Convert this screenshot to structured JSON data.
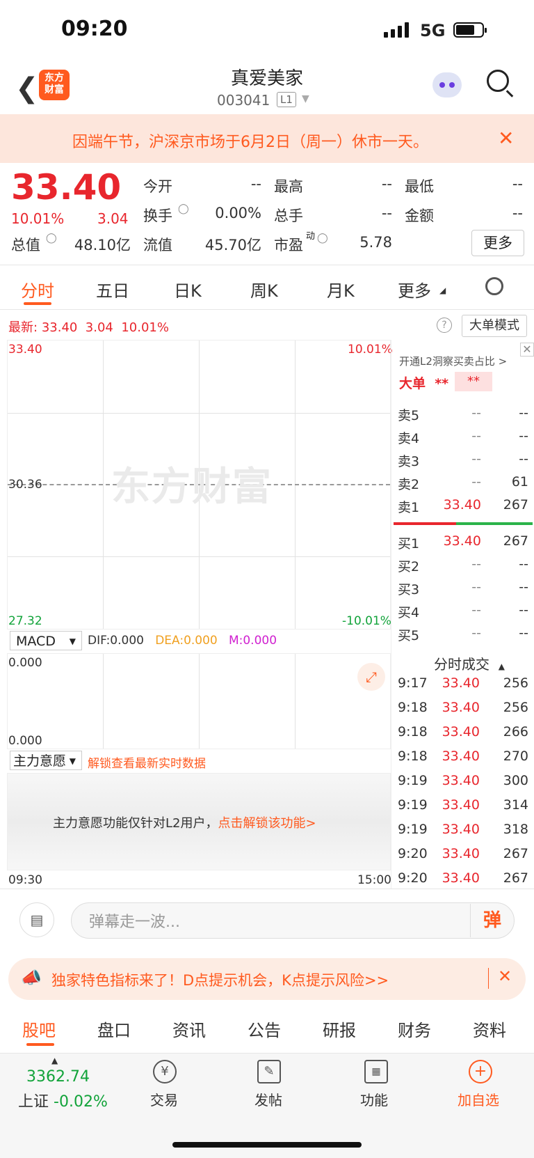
{
  "status_bar": {
    "time": "09:20",
    "network": "5G"
  },
  "header": {
    "logo_line1": "东方",
    "logo_line2": "财富",
    "stock_name": "真爱美家",
    "stock_code": "003041",
    "level_badge": "L1"
  },
  "notice": {
    "text": "因端午节，沪深京市场于6月2日（周一）休市一天。"
  },
  "quote": {
    "price": "33.40",
    "change_pct": "10.01%",
    "change": "3.04",
    "fields": [
      {
        "label": "今开",
        "value": "--"
      },
      {
        "label": "最高",
        "value": "--"
      },
      {
        "label": "最低",
        "value": "--"
      },
      {
        "label": "换手",
        "value": "0.00%"
      },
      {
        "label": "总手",
        "value": "--"
      },
      {
        "label": "金额",
        "value": "--"
      },
      {
        "label": "总值",
        "value": "48.10亿"
      },
      {
        "label": "流值",
        "value": "45.70亿"
      },
      {
        "label": "市盈",
        "value": "5.78"
      }
    ],
    "pe_sup": "动",
    "more_label": "更多"
  },
  "tabs": [
    "分时",
    "五日",
    "日K",
    "周K",
    "月K",
    "更多"
  ],
  "latest": {
    "label": "最新:",
    "price": "33.40",
    "change": "3.04",
    "pct": "10.01%"
  },
  "big_mode_label": "大单模式",
  "chart": {
    "max_label": "33.40",
    "max_pct": "10.01%",
    "mid_label": "30.36",
    "min_label": "27.32",
    "min_pct": "-10.01%",
    "watermark": "东方财富",
    "time_start": "09:30",
    "time_end": "15:00"
  },
  "macd": {
    "selector": "MACD",
    "dif": "DIF:0.000",
    "dea": "DEA:0.000",
    "m": "M:0.000",
    "top": "0.000",
    "bottom": "0.000"
  },
  "zhuli": {
    "selector": "主力意愿",
    "unlock": "解锁查看最新实时数据",
    "msg": "主力意愿功能仅针对L2用户，",
    "link": "点击解锁该功能>"
  },
  "right_panel": {
    "l2_label": "开通L2洞察买卖占比 >",
    "dadan": "大单",
    "dadan_v1": "**",
    "dadan_v2": "**",
    "sells": [
      {
        "label": "卖5",
        "price": "--",
        "vol": "--"
      },
      {
        "label": "卖4",
        "price": "--",
        "vol": "--"
      },
      {
        "label": "卖3",
        "price": "--",
        "vol": "--"
      },
      {
        "label": "卖2",
        "price": "--",
        "vol": "61"
      },
      {
        "label": "卖1",
        "price": "33.40",
        "vol": "267"
      }
    ],
    "buys": [
      {
        "label": "买1",
        "price": "33.40",
        "vol": "267"
      },
      {
        "label": "买2",
        "price": "--",
        "vol": "--"
      },
      {
        "label": "买3",
        "price": "--",
        "vol": "--"
      },
      {
        "label": "买4",
        "price": "--",
        "vol": "--"
      },
      {
        "label": "买5",
        "price": "--",
        "vol": "--"
      }
    ],
    "trades_title": "分时成交",
    "trades": [
      {
        "time": "9:17",
        "price": "33.40",
        "vol": "256"
      },
      {
        "time": "9:18",
        "price": "33.40",
        "vol": "256"
      },
      {
        "time": "9:18",
        "price": "33.40",
        "vol": "266"
      },
      {
        "time": "9:18",
        "price": "33.40",
        "vol": "270"
      },
      {
        "time": "9:19",
        "price": "33.40",
        "vol": "300"
      },
      {
        "time": "9:19",
        "price": "33.40",
        "vol": "314"
      },
      {
        "time": "9:19",
        "price": "33.40",
        "vol": "318"
      },
      {
        "time": "9:20",
        "price": "33.40",
        "vol": "267"
      },
      {
        "time": "9:20",
        "price": "33.40",
        "vol": "267"
      }
    ]
  },
  "comment": {
    "placeholder": "弹幕走一波...",
    "danmu_btn": "弹"
  },
  "promo": {
    "text": "独家特色指标来了！D点提示机会，K点提示风险>>"
  },
  "bottom_tabs": [
    "股吧",
    "盘口",
    "资讯",
    "公告",
    "研报",
    "财务",
    "资料"
  ],
  "bottom_nav": {
    "index_value": "3362.74",
    "index_name": "上证",
    "index_pct": "-0.02%",
    "items": [
      "交易",
      "发帖",
      "功能",
      "加自选"
    ]
  },
  "colors": {
    "up": "#e8262d",
    "down": "#12a33a",
    "accent": "#ff5a1f"
  }
}
